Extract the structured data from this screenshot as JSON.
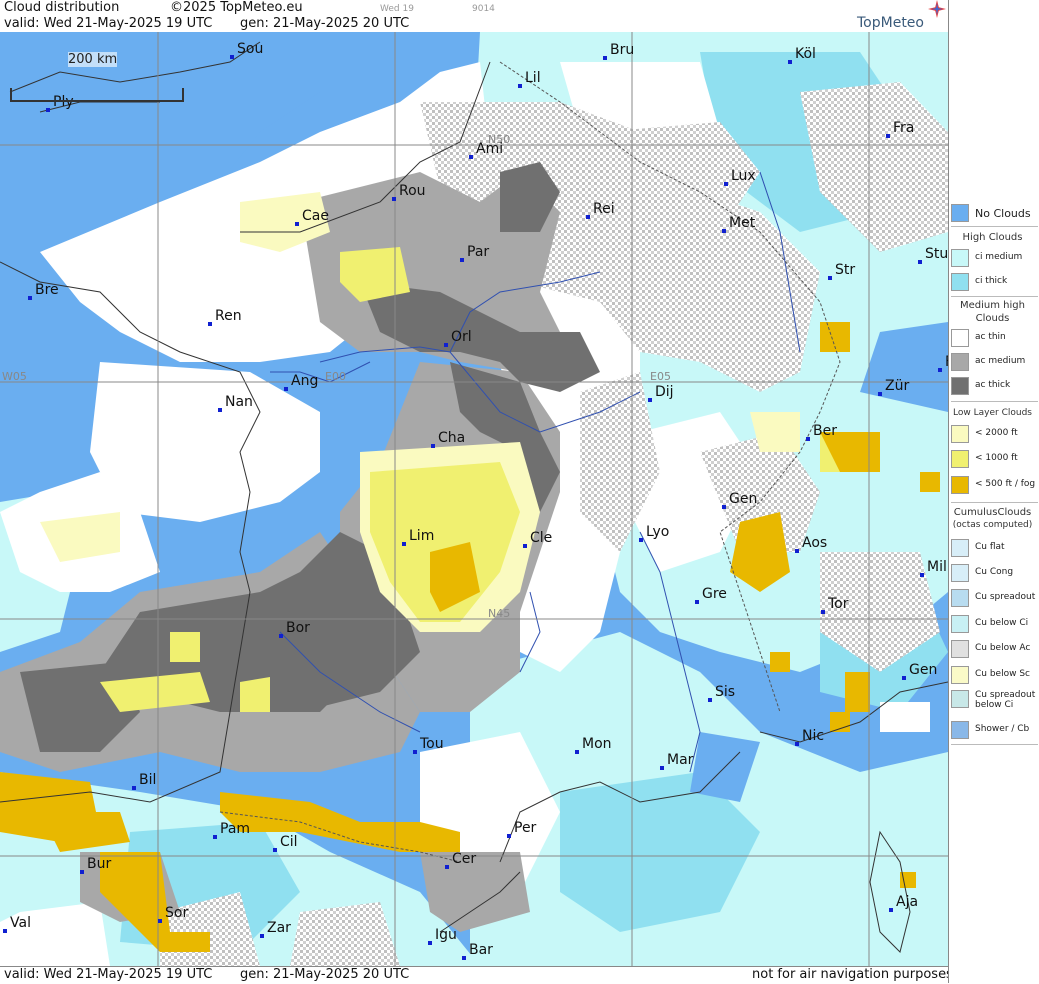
{
  "header": {
    "title": "Cloud distribution",
    "copyright": "©2025 TopMeteo.eu",
    "valid": "valid:  Wed  21-May-2025  19 UTC",
    "gen": "gen: 21-May-2025 20 UTC",
    "day_small": "Wed 19",
    "code_small": "9014",
    "brand": "TopMeteo"
  },
  "footer": {
    "valid": "valid:  Wed  21-May-2025  19 UTC",
    "gen": "gen: 21-May-2025 20 UTC",
    "disclaimer": "not for air navigation purposes"
  },
  "scale_label": "200 km",
  "grid_labels": {
    "n50": "N50",
    "n45": "N45",
    "w05": "W05",
    "e00": "E00",
    "e05": "E05"
  },
  "cities": [
    {
      "name": "Sou"
    },
    {
      "name": "Ply"
    },
    {
      "name": "Bru"
    },
    {
      "name": "Köl"
    },
    {
      "name": "Lil"
    },
    {
      "name": "Fra"
    },
    {
      "name": "Ami"
    },
    {
      "name": "Lux"
    },
    {
      "name": "Rou"
    },
    {
      "name": "Cae"
    },
    {
      "name": "Rei"
    },
    {
      "name": "Met"
    },
    {
      "name": "Par"
    },
    {
      "name": "Stu"
    },
    {
      "name": "Str"
    },
    {
      "name": "Bre"
    },
    {
      "name": "Ren"
    },
    {
      "name": "Orl"
    },
    {
      "name": "Ang"
    },
    {
      "name": "Nan"
    },
    {
      "name": "Dij"
    },
    {
      "name": "Zür"
    },
    {
      "name": "Cha"
    },
    {
      "name": "Ber"
    },
    {
      "name": "Gen"
    },
    {
      "name": "Lim"
    },
    {
      "name": "Cle"
    },
    {
      "name": "Lyo"
    },
    {
      "name": "Aos"
    },
    {
      "name": "Mil"
    },
    {
      "name": "Gre"
    },
    {
      "name": "Tor"
    },
    {
      "name": "Bor"
    },
    {
      "name": "Gen"
    },
    {
      "name": "Sis"
    },
    {
      "name": "Nic"
    },
    {
      "name": "Tou"
    },
    {
      "name": "Mon"
    },
    {
      "name": "Mar"
    },
    {
      "name": "Bil"
    },
    {
      "name": "Pam"
    },
    {
      "name": "Cil"
    },
    {
      "name": "Per"
    },
    {
      "name": "Bur"
    },
    {
      "name": "Cer"
    },
    {
      "name": "Sor"
    },
    {
      "name": "Val"
    },
    {
      "name": "Zar"
    },
    {
      "name": "Igu"
    },
    {
      "name": "Aja"
    },
    {
      "name": "Bar"
    },
    {
      "name": "F"
    }
  ],
  "legend": {
    "no_clouds": {
      "label": "No Clouds",
      "color": "#6aaef0"
    },
    "high": {
      "title": "High Clouds",
      "items": [
        {
          "label": "ci medium",
          "color": "#c8f8f8"
        },
        {
          "label": "ci thick",
          "color": "#90e0f0"
        }
      ]
    },
    "medium": {
      "title_line1": "Medium high",
      "title_line2": "Clouds",
      "items": [
        {
          "label": "ac thin",
          "color": "#ffffff"
        },
        {
          "label": "ac medium",
          "color": "#a8a8a8"
        },
        {
          "label": "ac thick",
          "color": "#707070"
        }
      ]
    },
    "low": {
      "title": "Low Layer Clouds",
      "items": [
        {
          "label": "< 2000 ft",
          "color": "#fafac0"
        },
        {
          "label": "< 1000 ft",
          "color": "#f0f070"
        },
        {
          "label": "< 500 ft / fog",
          "color": "#e8b800"
        }
      ]
    },
    "cumulus": {
      "title_line1": "CumulusClouds",
      "title_line2": "(octas computed)",
      "items": [
        {
          "label": "Cu flat",
          "color": "#d8eef8"
        },
        {
          "label": "Cu Cong",
          "color": "#d8eef8"
        },
        {
          "label": "Cu spreadout",
          "color": "#b8dcf0"
        },
        {
          "label": "Cu below Ci",
          "color": "#c8f0f4"
        },
        {
          "label": "Cu below Ac",
          "color": "#e0e0e0"
        },
        {
          "label": "Cu below Sc",
          "color": "#fafac8"
        },
        {
          "label": "Cu spreadout",
          "color": "#c8e8e8"
        },
        {
          "label": "below Ci",
          "color": ""
        },
        {
          "label": "Shower / Cb",
          "color": "#8ab8e8"
        }
      ]
    }
  }
}
